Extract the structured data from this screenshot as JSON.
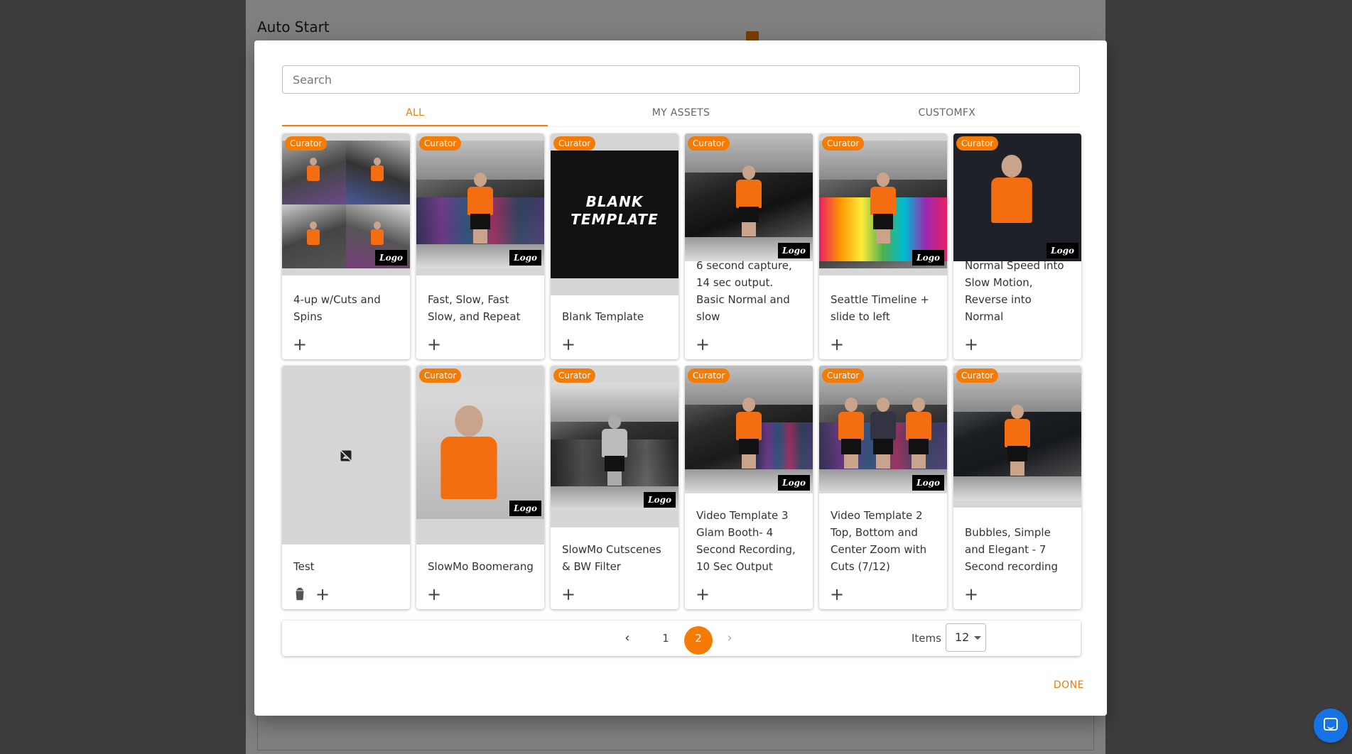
{
  "background": {
    "title": "Auto Start"
  },
  "modal": {
    "search": {
      "placeholder": "Search",
      "value": ""
    },
    "tabs": [
      {
        "label": "ALL",
        "active": true
      },
      {
        "label": "MY ASSETS",
        "active": false
      },
      {
        "label": "CUSTOMFX",
        "active": false
      }
    ],
    "badge_label": "Curator",
    "logo_label": "Logo",
    "blank_thumb_text": "BLANK TEMPLATE",
    "cards": [
      {
        "title": "4-up w/Cuts and Spins",
        "curator": true,
        "thumb": "quad",
        "actions": [
          "add"
        ]
      },
      {
        "title": "Fast, Slow, Fast Slow, and Repeat",
        "curator": true,
        "thumb": "color",
        "actions": [
          "add"
        ]
      },
      {
        "title": "Blank Template",
        "curator": true,
        "thumb": "blank",
        "actions": [
          "add"
        ]
      },
      {
        "title": "6 second capture, 14 sec output. Basic Normal and slow",
        "curator": true,
        "thumb": "color",
        "actions": [
          "add"
        ]
      },
      {
        "title": "Seattle Timeline + slide to left",
        "curator": true,
        "thumb": "rainbow",
        "actions": [
          "add"
        ]
      },
      {
        "title": "Normal Speed into Slow Motion, Reverse into Normal",
        "curator": true,
        "thumb": "dark",
        "actions": [
          "add"
        ]
      },
      {
        "title": "Test",
        "curator": false,
        "thumb": "none",
        "actions": [
          "delete",
          "add"
        ]
      },
      {
        "title": "SlowMo Boomerang",
        "curator": true,
        "thumb": "closeup",
        "actions": [
          "add"
        ]
      },
      {
        "title": "SlowMo Cutscenes & BW Filter",
        "curator": true,
        "thumb": "bw",
        "actions": [
          "add"
        ]
      },
      {
        "title": "Video Template 3 Glam Booth- 4 Second Recording, 10 Sec Output",
        "curator": true,
        "thumb": "color",
        "actions": [
          "add"
        ]
      },
      {
        "title": "Video Template 2 Top, Bottom and Center Zoom with Cuts (7/12)",
        "curator": true,
        "thumb": "split",
        "actions": [
          "add"
        ]
      },
      {
        "title": "Bubbles, Simple and Elegant - 7 Second recording",
        "curator": true,
        "thumb": "dark",
        "actions": [
          "add"
        ]
      }
    ],
    "pagination": {
      "prev_icon": "chevron-left-icon",
      "pages": [
        "1",
        "2"
      ],
      "current": "2",
      "next_icon": "chevron-right-icon",
      "items_label": "Items",
      "items_per_page": "12"
    },
    "done_label": "DONE"
  },
  "colors": {
    "accent": "#f47b06",
    "chat": "#1673e6"
  }
}
